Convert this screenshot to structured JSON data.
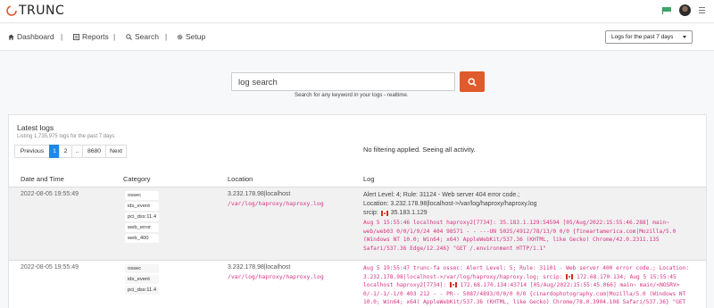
{
  "brand": {
    "name": "TRUNC"
  },
  "nav": {
    "items": [
      {
        "label": "Dashboard",
        "icon": "home-icon"
      },
      {
        "label": "Reports",
        "icon": "report-icon"
      },
      {
        "label": "Search",
        "icon": "search-icon"
      },
      {
        "label": "Setup",
        "icon": "gear-icon"
      }
    ],
    "separator": "|",
    "range_select": "Logs for the past 7 days"
  },
  "search": {
    "value": "log search",
    "hint": "Search for any keyword in your logs - realtime."
  },
  "results": {
    "title": "Latest logs",
    "subtitle": "Listing 1,735,975 logs for the past 7 days",
    "filter_note": "No filtering applied. Seeing all activity.",
    "pagination": [
      "Previous",
      "1",
      "2",
      "..",
      "8680",
      "Next"
    ],
    "active_page": "1",
    "columns": [
      "Date and Time",
      "Category",
      "Location",
      "Log"
    ],
    "rows": [
      {
        "date": "2022-08-05 19:55:49",
        "categories": [
          "ossec",
          "ids_event",
          "pci_dss:11.4",
          "web_error",
          "web_400"
        ],
        "location_ip": "3.232.178.98|localhost",
        "location_path": "/var/log/haproxy/haproxy.log",
        "log_lines": [
          "Alert Level: 4; Rule: 31124 - Web server 404 error code.;",
          "Location: 3.232.178.98|localhost->/var/log/haproxy/haproxy.log",
          "srcip:"
        ],
        "srcip": "35.183.1.129",
        "raw": "Aug 5 15:55:46 localhost haproxy2[7734]: 35.183.1.129:54594 [05/Aug/2022:15:55:46.288] main~ web/web03 0/0/1/9/24 404 98571 - - ---UN 5025/4912/78/13/0 0/0 {fineartamerica.com|Mozilla/5.0 (Windows NT 10.0; Win64; x64) AppleWebKit/537.36 (KHTML, like Gecko) Chrome/42.0.2311.135 Safari/537.36 Edge/12.246} \"GET /.environment HTTP/1.1\""
      },
      {
        "date": "2022-08-05 19:55:49",
        "categories": [
          "ossec",
          "ids_event",
          "pci_dss:11.4"
        ],
        "location_ip": "3.232.178.98|localhost",
        "location_path": "/var/log/haproxy/haproxy.log",
        "raw_a": "Aug 5 19:55:47 trunc-fa ossec: Alert Level: 5; Rule: 31101 - Web server 400 error code.; Location: 3.232.178.98|localhost->/var/log/haproxy/haproxy.log; srcip:",
        "raw_ip1": "172.68.170.134",
        "raw_b": "; Aug 5 15:55:45 localhost haproxy2[7734]:",
        "raw_ip2": "172.68.170.134",
        "raw_c": ":43714 [05/Aug/2022:15:55:45.066] main~ main/<NOSRV> 0/-1/-1/-1/0 403 212 - - PR-- 5087/4893/0/0/0 0/0 {cinardophotography.com|Mozilla/5.0 (Windows NT 10.0; Win64; x64) AppleWebKit/537.36 (KHTML, like Gecko) Chrome/78.0.3904.108 Safari/537.36} \"GET"
      }
    ]
  },
  "colors": {
    "accent": "#e05a2b",
    "active_page": "#1e88e5",
    "code": "#d63384"
  }
}
